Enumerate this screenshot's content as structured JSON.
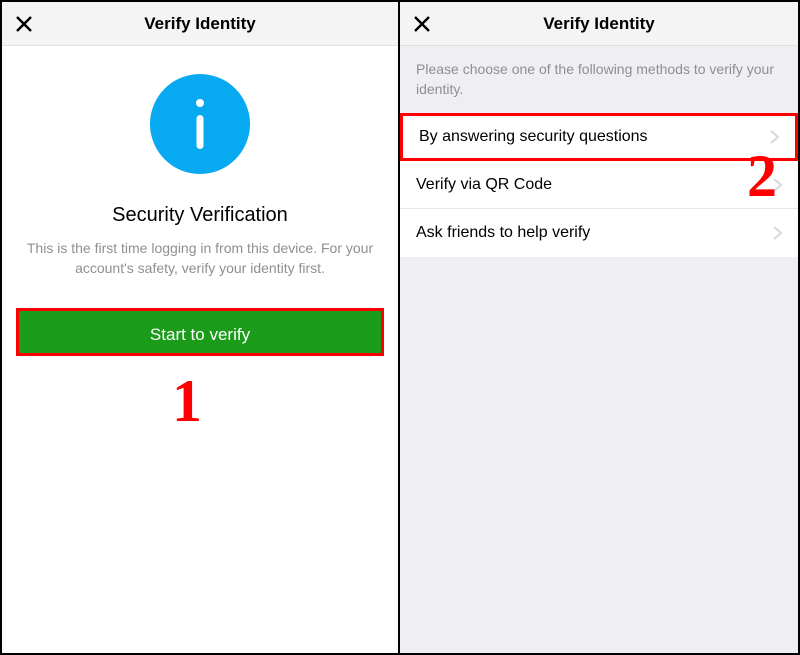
{
  "pane_left": {
    "header_title": "Verify Identity",
    "section_title": "Security Verification",
    "description": "This is the first time logging in from this device. For your account's safety, verify your identity first.",
    "start_button": "Start to verify",
    "annotation": "1"
  },
  "pane_right": {
    "header_title": "Verify Identity",
    "intro": "Please choose one of the following methods to verify your identity.",
    "options": [
      {
        "label": "By answering security questions"
      },
      {
        "label": "Verify via QR Code"
      },
      {
        "label": "Ask friends to help verify"
      }
    ],
    "annotation": "2"
  }
}
